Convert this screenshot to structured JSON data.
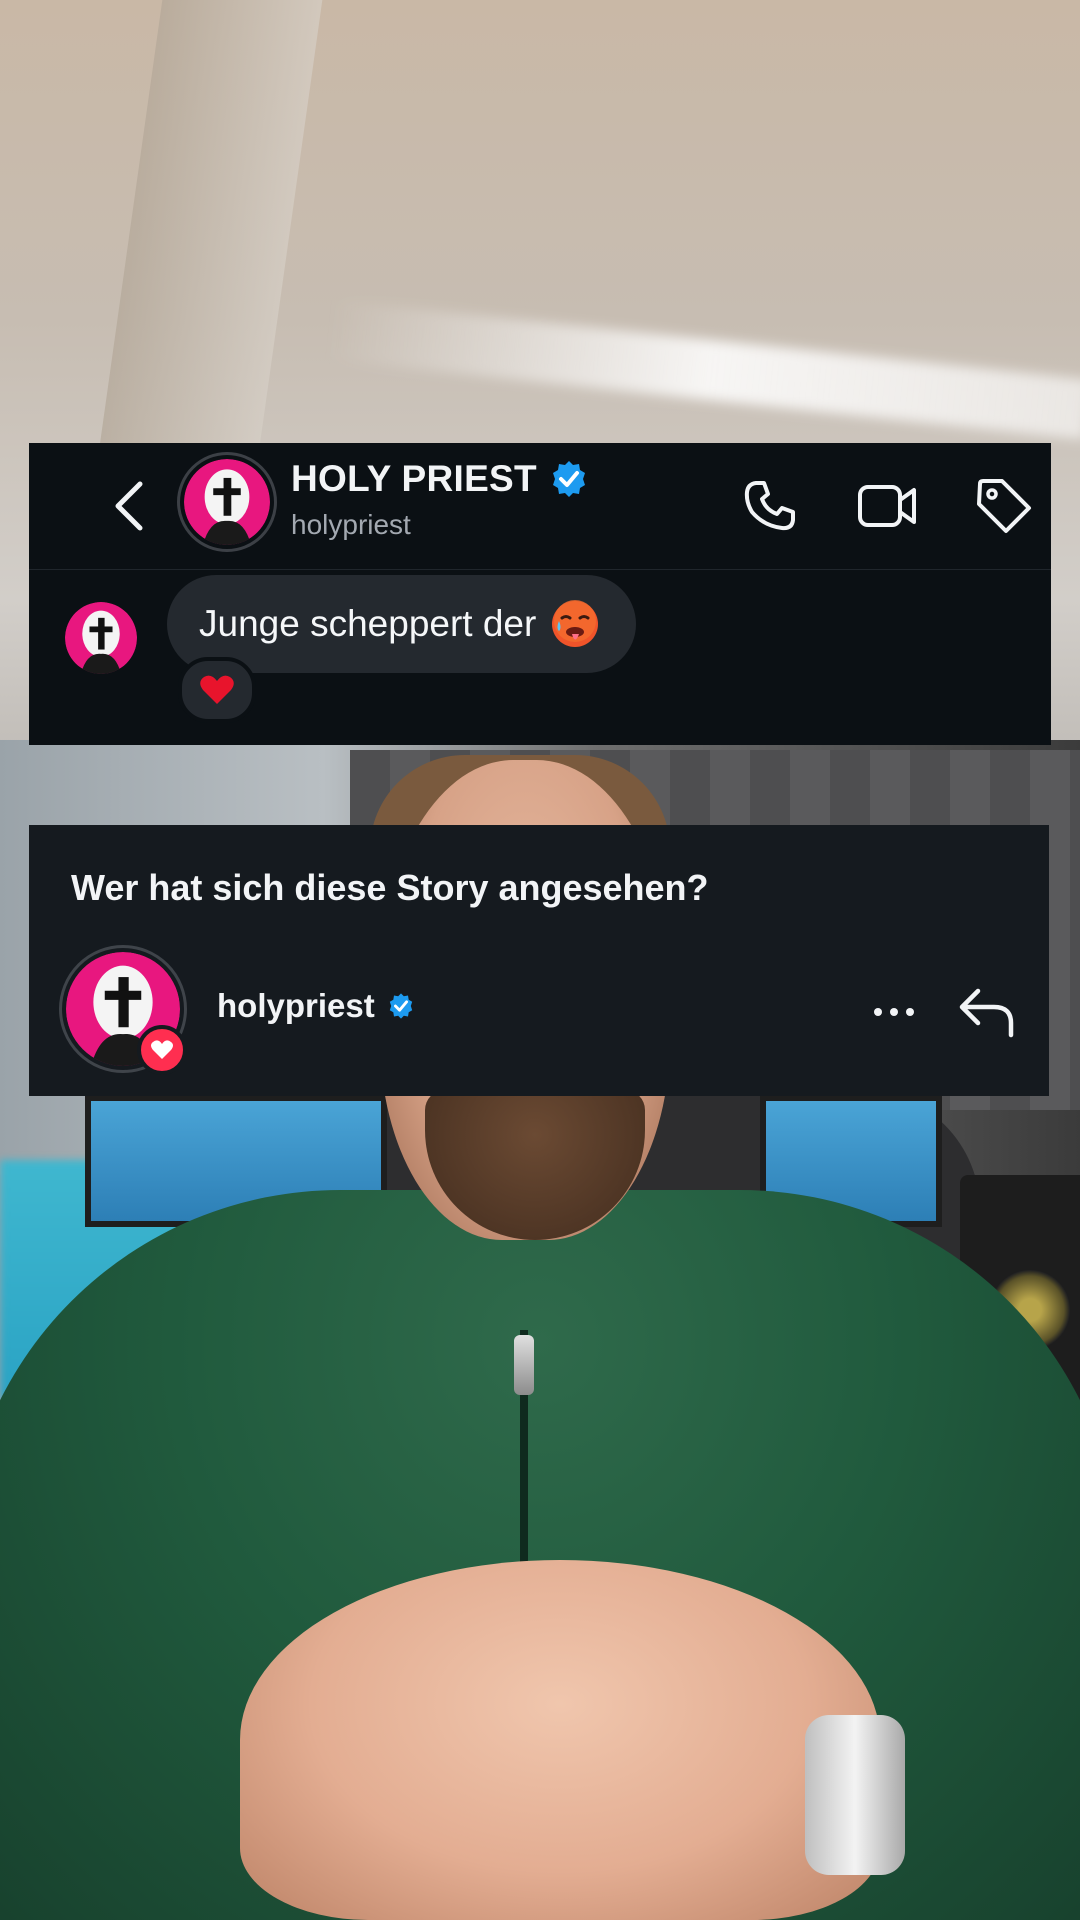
{
  "dm": {
    "name": "HOLY PRIEST",
    "handle": "holypriest",
    "verified": true,
    "message": {
      "text": "Junge scheppert der",
      "emoji": "hot-face-emoji",
      "reaction": "red-heart-emoji"
    }
  },
  "story_viewers": {
    "title": "Wer hat sich diese Story angesehen?",
    "viewers": [
      {
        "username": "holypriest",
        "verified": true,
        "liked": true
      }
    ]
  },
  "colors": {
    "verified_blue": "#1d9bf0",
    "avatar_pink": "#e8177f",
    "like_red": "#ff2e50"
  }
}
